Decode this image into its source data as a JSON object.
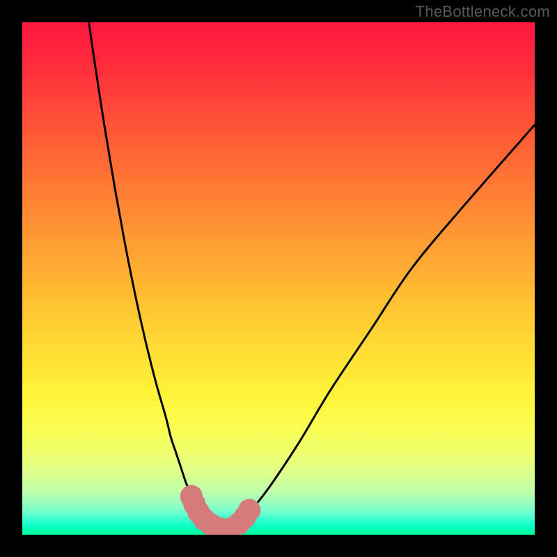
{
  "watermark": "TheBottleneck.com",
  "chart_data": {
    "type": "line",
    "title": "",
    "xlabel": "",
    "ylabel": "",
    "xlim": [
      0,
      100
    ],
    "ylim": [
      0,
      100
    ],
    "grid": false,
    "legend": false,
    "background_gradient": {
      "direction": "vertical",
      "stops": [
        {
          "pos": 0.0,
          "color": "#ff173f"
        },
        {
          "pos": 0.5,
          "color": "#ffd634"
        },
        {
          "pos": 0.8,
          "color": "#fcff5a"
        },
        {
          "pos": 1.0,
          "color": "#00ff97"
        }
      ]
    },
    "series": [
      {
        "name": "curve",
        "color": "#000000",
        "x": [
          13,
          14,
          16,
          18,
          20,
          22,
          24,
          26,
          28,
          29,
          30,
          31,
          32,
          33,
          34,
          35,
          36,
          37,
          38,
          39,
          40,
          41,
          42,
          44,
          48,
          54,
          60,
          68,
          76,
          86,
          100
        ],
        "y": [
          100,
          93,
          80,
          68,
          57,
          47,
          38,
          30,
          23,
          19,
          16,
          13,
          10,
          8,
          6,
          4,
          3,
          2,
          1.5,
          1,
          1,
          1.5,
          2,
          4,
          9,
          18,
          28,
          40,
          52,
          64,
          80
        ]
      }
    ],
    "markers": [
      {
        "name": "flat-minimum-band",
        "color": "#d57b7b",
        "radius": 2.2,
        "points": [
          {
            "x": 33.0,
            "y": 7.5
          },
          {
            "x": 33.6,
            "y": 6.0
          },
          {
            "x": 34.4,
            "y": 4.4
          },
          {
            "x": 35.5,
            "y": 3.0
          },
          {
            "x": 36.8,
            "y": 2.0
          },
          {
            "x": 38.2,
            "y": 1.3
          },
          {
            "x": 39.6,
            "y": 1.0
          },
          {
            "x": 41.0,
            "y": 1.3
          },
          {
            "x": 42.3,
            "y": 2.2
          },
          {
            "x": 43.4,
            "y": 3.4
          },
          {
            "x": 44.3,
            "y": 4.8
          }
        ]
      }
    ]
  }
}
